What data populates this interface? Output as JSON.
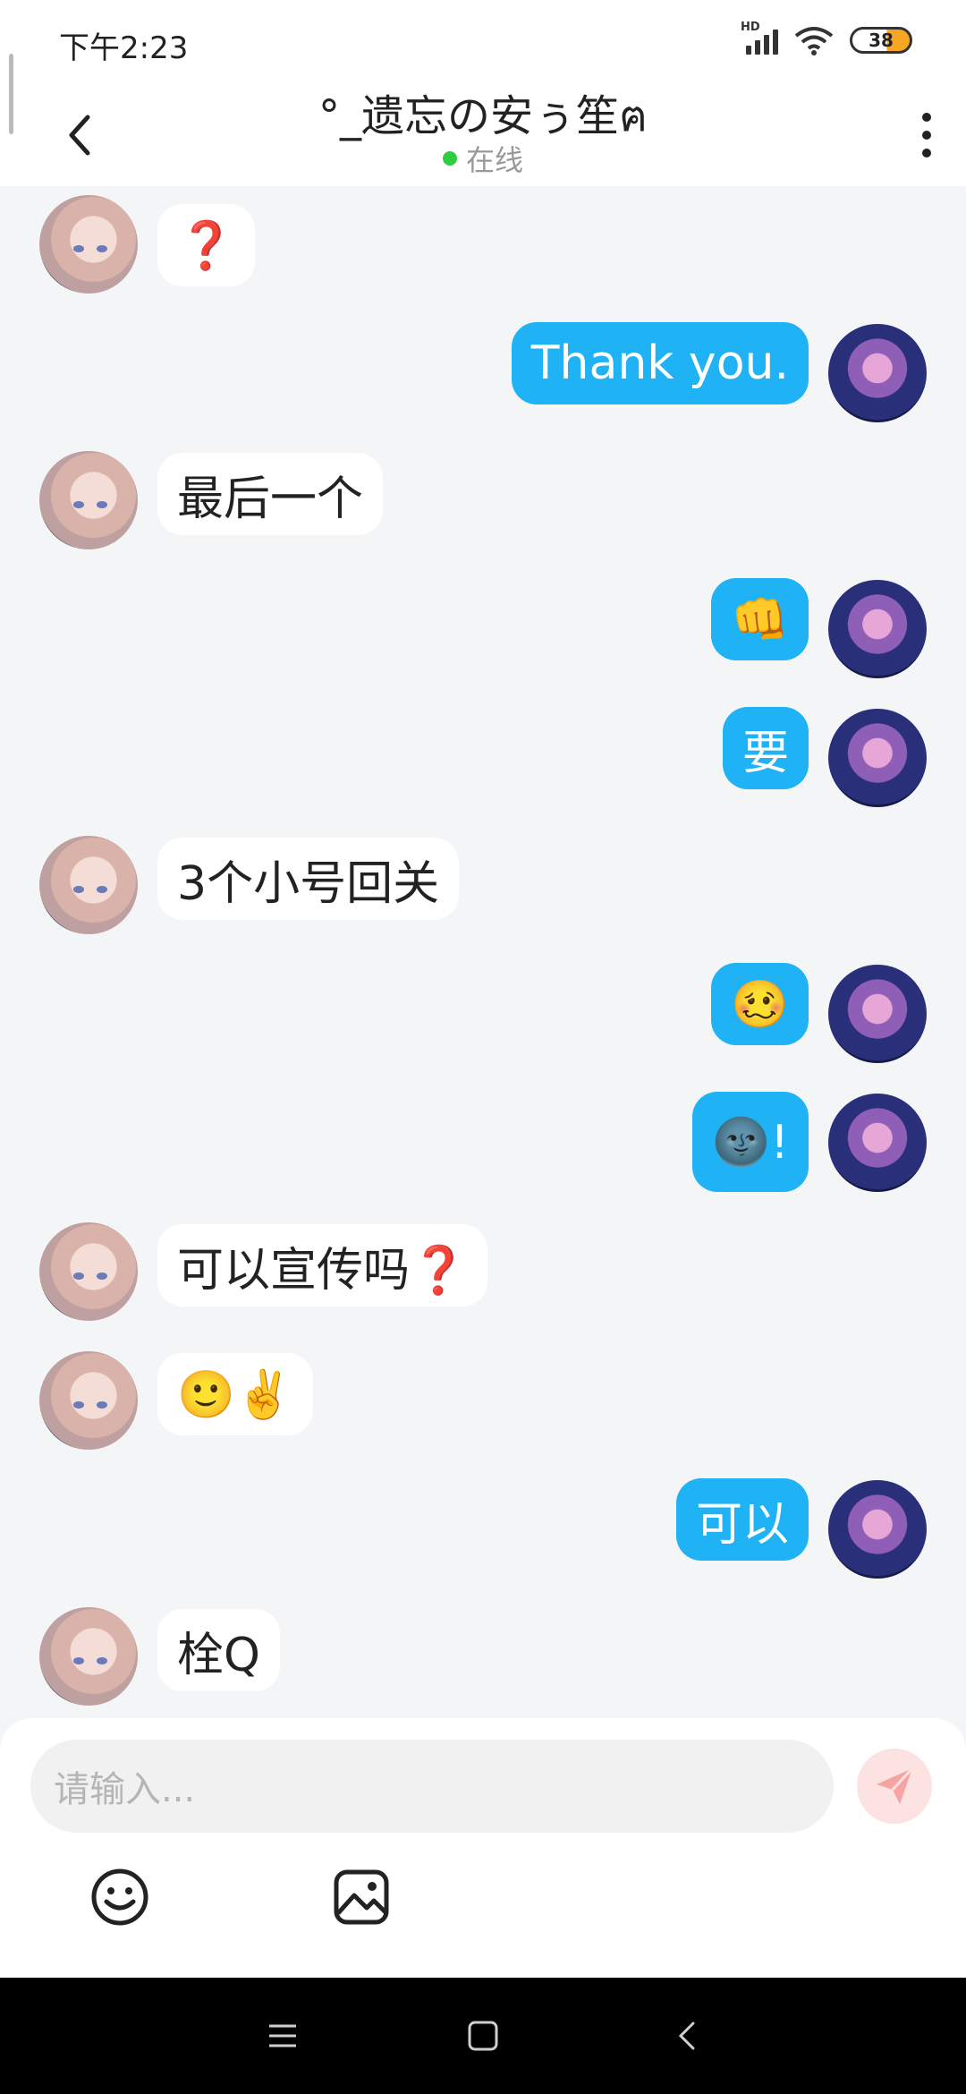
{
  "status_bar": {
    "time": "下午2:23",
    "network_label": "HD",
    "battery_level": "38",
    "battery_color": "#f5a623"
  },
  "header": {
    "title": "°_遗忘の安ぅ笙ฅ",
    "status": "在线",
    "status_color": "#2ecc40",
    "back_icon": "chevron-left-icon",
    "more_icon": "more-vertical-icon"
  },
  "messages": [
    {
      "side": "left",
      "text": "❓"
    },
    {
      "side": "right",
      "text": "Thank you."
    },
    {
      "side": "left",
      "text": "最后一个"
    },
    {
      "side": "right",
      "text": "👊"
    },
    {
      "side": "right",
      "text": "要"
    },
    {
      "side": "left",
      "text": "3个小号回关"
    },
    {
      "side": "right",
      "text": "🥴"
    },
    {
      "side": "right",
      "text": "🌚!"
    },
    {
      "side": "left",
      "text": "可以宣传吗❓"
    },
    {
      "side": "left",
      "text": "🙂✌️"
    },
    {
      "side": "right",
      "text": "可以"
    },
    {
      "side": "left",
      "text": "栓Q"
    }
  ],
  "input": {
    "placeholder": "请输入..."
  },
  "toolbar": {
    "send_icon": "send-icon",
    "emoji_icon": "emoji-icon",
    "image_icon": "image-icon"
  },
  "colors": {
    "bubble_sent": "#1fb2f5",
    "bubble_received": "#ffffff",
    "background": "#f4f5f7"
  }
}
